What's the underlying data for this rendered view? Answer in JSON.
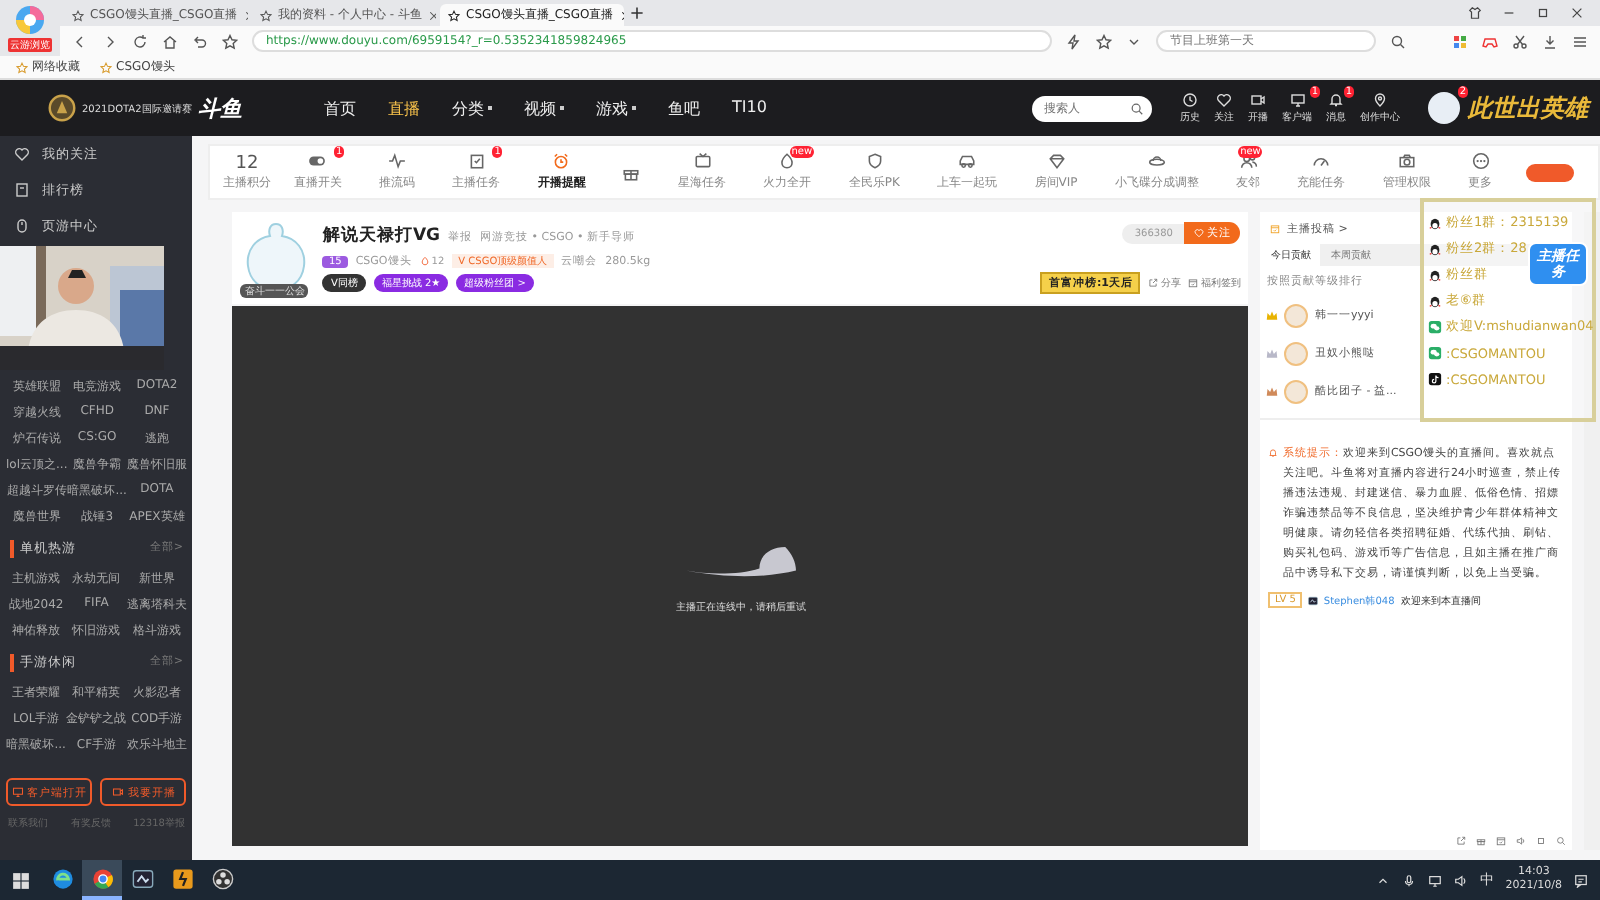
{
  "browser": {
    "badge": "云游浏览",
    "tabs": [
      {
        "title": "CSGO馒头直播_CSGO直播",
        "selected": false
      },
      {
        "title": "我的资料 - 个人中心 - 斗鱼",
        "selected": false
      },
      {
        "title": "CSGO馒头直播_CSGO直播",
        "selected": true
      }
    ],
    "address": "https://www.douyu.com/6959154?_r=0.5352341859824965",
    "search_placeholder": "节目上班第一天",
    "bookmarks": [
      "网络收藏",
      "CSGO馒头"
    ]
  },
  "site": {
    "logo_caption": "2021DOTA2国际邀请赛",
    "logo": "斗鱼",
    "nav": [
      {
        "label": "首页",
        "selected": false,
        "dropdown": false
      },
      {
        "label": "直播",
        "selected": true,
        "dropdown": false
      },
      {
        "label": "分类",
        "selected": false,
        "dropdown": true
      },
      {
        "label": "视频",
        "selected": false,
        "dropdown": true
      },
      {
        "label": "游戏",
        "selected": false,
        "dropdown": true
      },
      {
        "label": "鱼吧",
        "selected": false,
        "dropdown": false
      },
      {
        "label": "TI10",
        "selected": false,
        "dropdown": false
      }
    ],
    "search_placeholder": "搜索人",
    "actions": [
      {
        "label": "历史"
      },
      {
        "label": "关注"
      },
      {
        "label": "开播"
      },
      {
        "label": "客户端",
        "badge": "1"
      },
      {
        "label": "消息",
        "badge": "1"
      },
      {
        "label": "创作中心"
      }
    ],
    "avatar_badge": "2",
    "banner": "此世出英雄"
  },
  "sidebar": {
    "links": [
      "我的关注",
      "排行榜",
      "页游中心"
    ],
    "sections": [
      {
        "items": [
          "英雄联盟",
          "电竞游戏",
          "DOTA2",
          "穿越火线",
          "CFHD",
          "DNF",
          "炉石传说",
          "CS:GO",
          "逃跑",
          "lol云顶之...",
          "魔兽争霸",
          "魔兽怀旧服",
          "超越斗罗传",
          "暗黑破坏...",
          "DOTA",
          "魔兽世界",
          "战锤3",
          "APEX英雄"
        ]
      },
      {
        "title": "单机热游",
        "more": "全部>",
        "items": [
          "主机游戏",
          "永劫无间",
          "新世界",
          "战地2042",
          "FIFA",
          "逃离塔科夫",
          "神佑释放",
          "怀旧游戏",
          "格斗游戏"
        ]
      },
      {
        "title": "手游休闲",
        "more": "全部>",
        "items": [
          "王者荣耀",
          "和平精英",
          "火影忍者",
          "LOL手游",
          "金铲铲之战",
          "COD手游",
          "暗黑破坏...",
          "CF手游",
          "欢乐斗地主"
        ]
      }
    ],
    "buttons": [
      "客户端打开",
      "我要开播"
    ],
    "footer_links": [
      "联系我们",
      "有奖反馈",
      "12318举报"
    ]
  },
  "toolbar": {
    "score": "12",
    "score_label": "主播积分",
    "tools": [
      {
        "label": "直播开关",
        "badge": "1",
        "selected": false
      },
      {
        "label": "推流码",
        "selected": false
      },
      {
        "label": "主播任务",
        "badge": "1",
        "selected": false
      },
      {
        "label": "开播提醒",
        "selected": true
      },
      {
        "selected": false
      },
      {
        "label": "星海任务",
        "selected": false
      },
      {
        "label": "火力全开",
        "badge": "new",
        "selected": false
      },
      {
        "label": "全民乐PK",
        "selected": false
      },
      {
        "label": "上车一起玩",
        "selected": false
      },
      {
        "label": "房间VIP",
        "selected": false
      },
      {
        "label": "小飞碟分成调整",
        "selected": false
      },
      {
        "label": "友邻",
        "badge": "new",
        "selected": false
      },
      {
        "label": "充能任务",
        "selected": false
      },
      {
        "label": "管理权限",
        "selected": false
      },
      {
        "label": "更多",
        "selected": false
      }
    ]
  },
  "streamer": {
    "name": "解说天禄打VG",
    "report": "举报",
    "category": "网游竞技 • CSGO • 新手导师",
    "avatar_caption": "奋斗一一公会",
    "level": "15",
    "room_name": "CSGO馒头",
    "heat": "12",
    "title_tag": "V CSGO顶级颜值人",
    "guild": "云嘲会",
    "weight": "280.5kg",
    "badges": [
      {
        "label": "V同榜",
        "kind": "dark"
      },
      {
        "label": "福星挑战 2★",
        "kind": "purple"
      },
      {
        "label": "超级粉丝团 >",
        "kind": "purple"
      }
    ],
    "follower_count": "366380",
    "follow": "关注",
    "rank_banner": "首富冲榜:1天后",
    "share": "分享",
    "checkin": "福利签到"
  },
  "video": {
    "message": "主播正在连线中，请稍后重试"
  },
  "chat": {
    "header": "主播投稿 >",
    "tabs": [
      {
        "label": "今日贡献",
        "selected": true
      },
      {
        "label": "本周贡献",
        "selected": false
      }
    ],
    "note": "按照贡献等级排行",
    "ranking": [
      {
        "name": "韩一一yyyi",
        "color": "#e8b300"
      },
      {
        "name": "丑奴小熊哒",
        "color": "#b8b8c8"
      },
      {
        "name": "酷比团子 - 益...",
        "color": "#d08a5a"
      }
    ],
    "messages": [
      {
        "kind": "system",
        "label": "系统提示：",
        "text": "欢迎来到CSGO馒头的直播间。喜欢就点关注吧。斗鱼将对直播内容进行24小时巡查，禁止传播违法违规、封建迷信、暴力血腥、低俗色情、招嫖诈骗违禁品等不良信息，坚决维护青少年群体精神文明健康。请勿轻信各类招聘征婚、代练代抽、刷钻、购买礼包码、游戏币等广告信息，且如主播在推广商品中诱导私下交易，请谨慎判断，以免上当受骗。"
      },
      {
        "kind": "user",
        "level": "LV 5",
        "user": "Stephen韩048",
        "text": "欢迎来到本直播间"
      }
    ]
  },
  "overlay": {
    "sticker": "主播任务",
    "lines": [
      {
        "kind": "qq",
        "text": "粉丝1群：2315139"
      },
      {
        "kind": "qq",
        "text": "粉丝2群：28"
      },
      {
        "kind": "qq",
        "text": "粉丝群"
      },
      {
        "kind": "qq",
        "text": "老⑥群"
      },
      {
        "kind": "wechat",
        "text": "欢迎V:mshudianwan04"
      },
      {
        "kind": "wechat",
        "text": ":CSGOMANTOU"
      },
      {
        "kind": "douyin",
        "text": ":CSGOMANTOU"
      }
    ]
  },
  "taskbar": {
    "apps": [
      {
        "selected": false
      },
      {
        "selected": true
      },
      {
        "selected": false
      },
      {
        "selected": false
      },
      {
        "selected": false
      }
    ],
    "ime": "中",
    "time": "14:03",
    "date": "2021/10/8"
  }
}
